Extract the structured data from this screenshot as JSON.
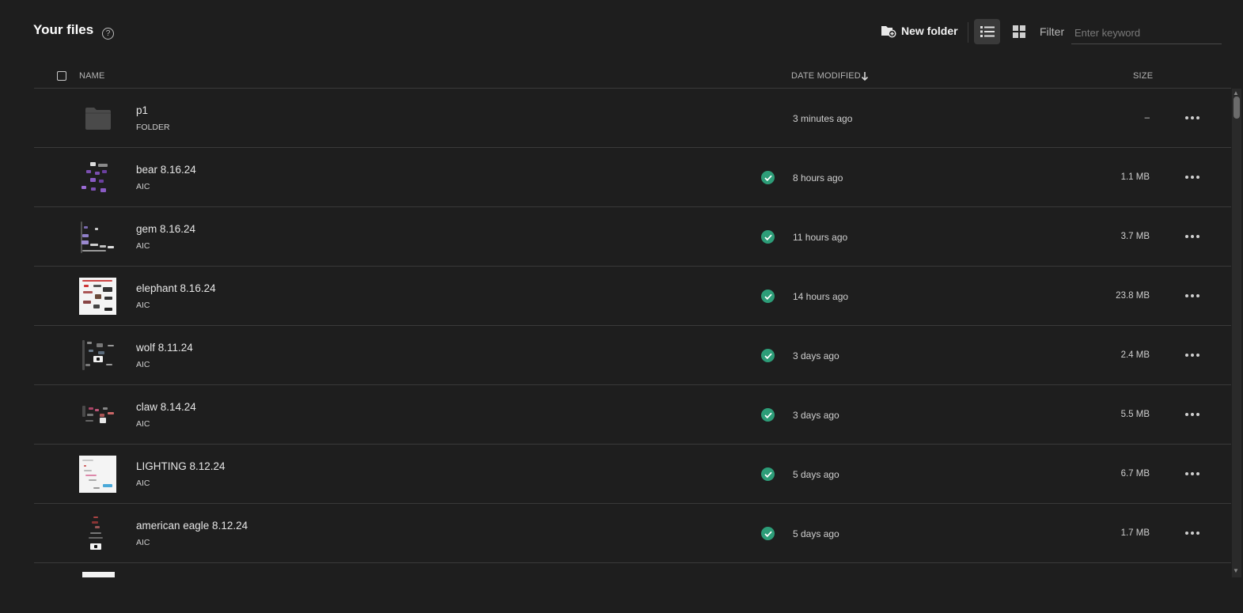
{
  "header": {
    "title": "Your files",
    "help_symbol": "?",
    "new_folder_label": "New folder",
    "view_modes": [
      "list-view-icon",
      "grid-view-icon"
    ],
    "active_view": "list",
    "filter_label": "Filter",
    "filter_placeholder": "Enter keyword",
    "filter_value": ""
  },
  "columns": {
    "name": "NAME",
    "date_modified": "DATE MODIFIED",
    "size": "SIZE",
    "sort": "date_modified-desc"
  },
  "rows": [
    {
      "name": "p1",
      "type": "FOLDER",
      "date": "3 minutes ago",
      "size": "–",
      "synced": false,
      "thumb": "folder-icon"
    },
    {
      "name": "bear 8.16.24",
      "type": "AIC",
      "date": "8 hours ago",
      "size": "1.1 MB",
      "synced": true,
      "thumb": "dark"
    },
    {
      "name": "gem 8.16.24",
      "type": "AIC",
      "date": "11 hours ago",
      "size": "3.7 MB",
      "synced": true,
      "thumb": "dark"
    },
    {
      "name": "elephant 8.16.24",
      "type": "AIC",
      "date": "14 hours ago",
      "size": "23.8 MB",
      "synced": true,
      "thumb": "light"
    },
    {
      "name": "wolf 8.11.24",
      "type": "AIC",
      "date": "3 days ago",
      "size": "2.4 MB",
      "synced": true,
      "thumb": "dark"
    },
    {
      "name": "claw 8.14.24",
      "type": "AIC",
      "date": "3 days ago",
      "size": "5.5 MB",
      "synced": true,
      "thumb": "dark"
    },
    {
      "name": "LIGHTING 8.12.24",
      "type": "AIC",
      "date": "5 days ago",
      "size": "6.7 MB",
      "synced": true,
      "thumb": "light"
    },
    {
      "name": "american eagle 8.12.24",
      "type": "AIC",
      "date": "5 days ago",
      "size": "1.7 MB",
      "synced": true,
      "thumb": "dark"
    }
  ],
  "colors": {
    "background": "#1e1e1e",
    "sync_green": "#2d9d78",
    "active_view_bg": "#3a3a3a",
    "divider": "#3a3a3a"
  }
}
